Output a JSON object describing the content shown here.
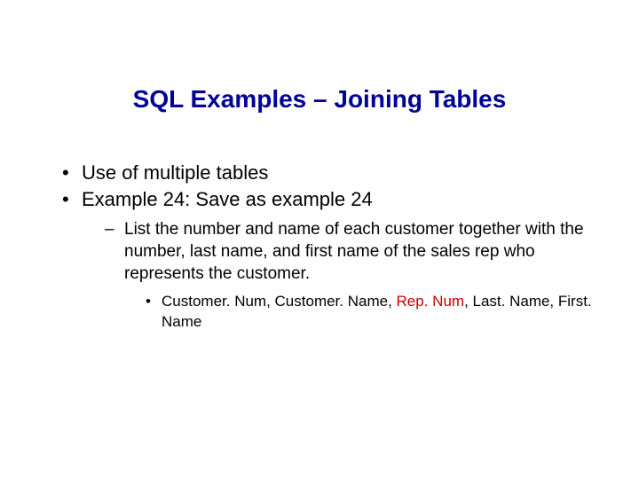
{
  "title": "SQL Examples – Joining Tables",
  "bullets": {
    "b1": "Use of multiple tables",
    "b2": "Example 24: Save as example 24",
    "sub1": "List the number and name of each customer together with the number, last name, and first name of the sales rep who represents the customer.",
    "fields": {
      "pre": "Customer. Num, Customer. Name, ",
      "red": "Rep. Num",
      "post": ", Last. Name, First. Name"
    }
  },
  "colors": {
    "title": "#000099",
    "accent": "#cc0000"
  }
}
